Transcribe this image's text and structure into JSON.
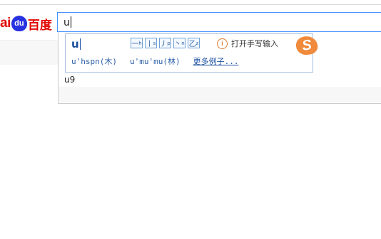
{
  "logo": {
    "part1": "ai",
    "paw": "du",
    "part2": "百度"
  },
  "search": {
    "value": "u"
  },
  "ime": {
    "composition": "u",
    "strokes": [
      {
        "glyph": "一",
        "hint": "h"
      },
      {
        "glyph": "丨",
        "hint": "s"
      },
      {
        "glyph": "丿",
        "hint": "p"
      },
      {
        "glyph": "丶",
        "hint": "n"
      },
      {
        "glyph": "乙",
        "hint": "z"
      }
    ],
    "handwriting_label": "打开手写输入",
    "logo_char": "S",
    "examples": [
      "u'hspn(木)",
      "u'mu'mu(林)"
    ],
    "more_examples": "更多例子..."
  },
  "suggestions": [
    "u9"
  ],
  "colors": {
    "accent_blue": "#4791ff",
    "baidu_red": "#e10601",
    "baidu_blue": "#2932e1",
    "sogou_orange": "#f08a3c"
  }
}
